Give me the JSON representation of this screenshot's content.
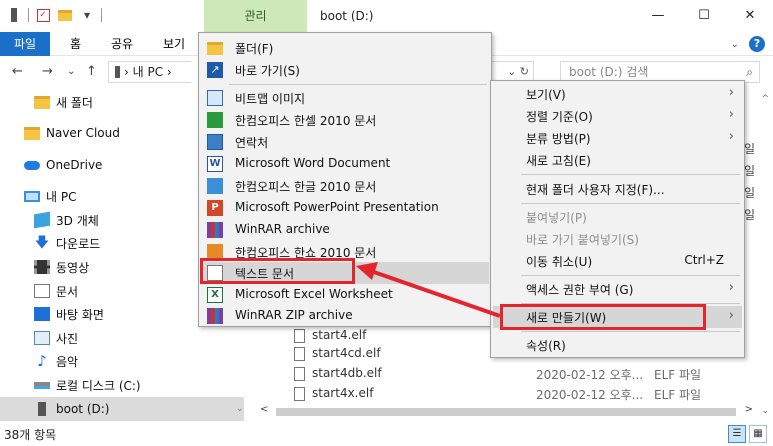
{
  "titlebar": {
    "manage_tab": "관리",
    "title": "boot (D:)",
    "qat_dropdown": "▾",
    "min": "—",
    "max": "☐",
    "close": "✕"
  },
  "ribbon": {
    "tabs": [
      "파일",
      "홈",
      "공유",
      "보기"
    ],
    "expand_chevron": "⌄",
    "help": "?"
  },
  "address": {
    "back": "←",
    "forward": "→",
    "recent": "⌄",
    "up": "↑",
    "path": "› 내 PC ›",
    "refresh": "⌄ ↻",
    "search_placeholder": "boot (D:) 검색",
    "search_icon": "⌕"
  },
  "navpane": {
    "items": [
      {
        "label": "새 폴더",
        "icon": "folder-icon"
      },
      {
        "label": "Naver Cloud",
        "icon": "folder-icon"
      },
      {
        "label": "OneDrive",
        "icon": "cloud-icon"
      },
      {
        "label": "내 PC",
        "icon": "pc-icon"
      },
      {
        "label": "3D 개체",
        "icon": "cube-icon"
      },
      {
        "label": "다운로드",
        "icon": "download-icon"
      },
      {
        "label": "동영상",
        "icon": "video-icon"
      },
      {
        "label": "문서",
        "icon": "document-icon"
      },
      {
        "label": "바탕 화면",
        "icon": "desktop-icon"
      },
      {
        "label": "사진",
        "icon": "picture-icon"
      },
      {
        "label": "음악",
        "icon": "music-icon"
      },
      {
        "label": "로컬 디스크 (C:)",
        "icon": "drive-icon"
      },
      {
        "label": "boot (D:)",
        "icon": "usb-drive-icon"
      }
    ],
    "scroll_down": "⌄"
  },
  "filelist": {
    "rows": [
      {
        "name": "start4.elf",
        "date": "",
        "type": ""
      },
      {
        "name": "start4cd.elf",
        "date": "2020-02-12 오후...",
        "type": "ELF 파일"
      },
      {
        "name": "start4db.elf",
        "date": "2020-02-12 오후...",
        "type": "ELF 파일"
      },
      {
        "name": "start4x.elf",
        "date": "2020-02-12 오후...",
        "type": "ELF 파일"
      }
    ],
    "side_glyphs": [
      "일",
      "일",
      "일",
      "일"
    ],
    "scroll_up": "^",
    "scroll_down": "⌄",
    "hscroll_left": "<",
    "hscroll_right": ">"
  },
  "submenu": {
    "items": [
      {
        "label": "폴더(F)",
        "icon": "folder-icon"
      },
      {
        "label": "바로 가기(S)",
        "icon": "shortcut-icon"
      },
      {
        "label": "비트맵 이미지",
        "icon": "bitmap-icon"
      },
      {
        "label": "한컴오피스 한셀 2010 문서",
        "icon": "hancell-icon"
      },
      {
        "label": "연락처",
        "icon": "contact-icon"
      },
      {
        "label": "Microsoft Word Document",
        "icon": "word-icon"
      },
      {
        "label": "한컴오피스 한글 2010 문서",
        "icon": "hwp-icon"
      },
      {
        "label": "Microsoft PowerPoint Presentation",
        "icon": "powerpoint-icon"
      },
      {
        "label": "WinRAR archive",
        "icon": "winrar-icon"
      },
      {
        "label": "한컴오피스 한쇼 2010 문서",
        "icon": "hanshow-icon"
      },
      {
        "label": "텍스트 문서",
        "icon": "text-document-icon"
      },
      {
        "label": "Microsoft Excel Worksheet",
        "icon": "excel-icon"
      },
      {
        "label": "WinRAR ZIP archive",
        "icon": "winrar-zip-icon"
      }
    ],
    "icon_glyphs": {
      "shortcut": "↗",
      "word": "W",
      "powerpoint": "P",
      "excel": "X"
    }
  },
  "ctxmenu": {
    "items": [
      {
        "label": "보기(V)",
        "arrow": "›",
        "shortcut": "",
        "disabled": false
      },
      {
        "label": "정렬 기준(O)",
        "arrow": "›",
        "shortcut": "",
        "disabled": false
      },
      {
        "label": "분류 방법(P)",
        "arrow": "›",
        "shortcut": "",
        "disabled": false
      },
      {
        "label": "새로 고침(E)",
        "arrow": "",
        "shortcut": "",
        "disabled": false
      },
      {
        "label": "현재 폴더 사용자 지정(F)...",
        "arrow": "",
        "shortcut": "",
        "disabled": false
      },
      {
        "label": "붙여넣기(P)",
        "arrow": "",
        "shortcut": "",
        "disabled": true
      },
      {
        "label": "바로 가기 붙여넣기(S)",
        "arrow": "",
        "shortcut": "",
        "disabled": true
      },
      {
        "label": "이동 취소(U)",
        "arrow": "",
        "shortcut": "Ctrl+Z",
        "disabled": false
      },
      {
        "label": "액세스 권한 부여 (G)",
        "arrow": "›",
        "shortcut": "",
        "disabled": false
      },
      {
        "label": "새로 만들기(W)",
        "arrow": "›",
        "shortcut": "",
        "disabled": false
      },
      {
        "label": "속성(R)",
        "arrow": "",
        "shortcut": "",
        "disabled": false
      }
    ]
  },
  "status": {
    "count": "38개 항목",
    "view_details": "☰",
    "view_large": "▦"
  },
  "colors": {
    "accent": "#1a6fc9",
    "manage_tab_bg": "#cfe8b8",
    "annotation_red": "#e3262e"
  }
}
